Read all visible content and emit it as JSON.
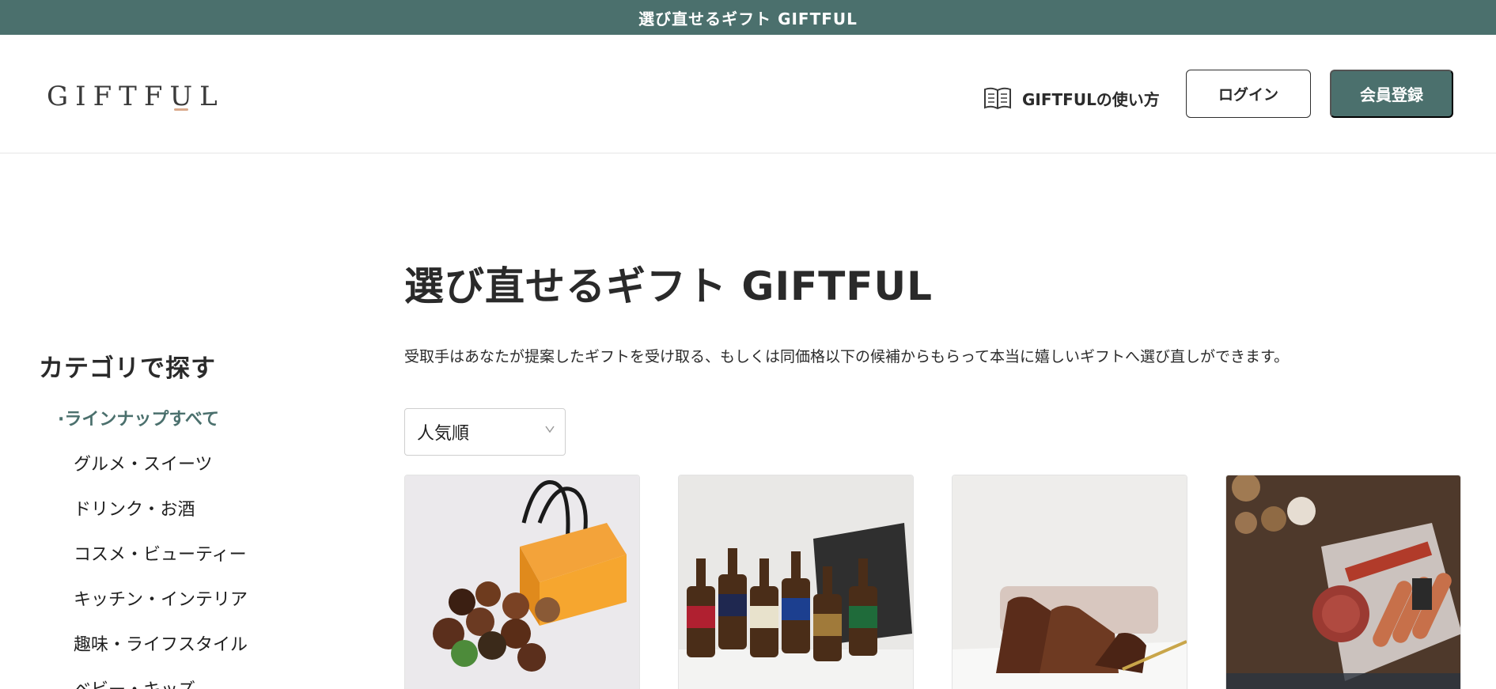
{
  "announcement": "選び直せるギフト GIFTFUL",
  "header": {
    "logo_text": "GIFTFUL",
    "howto_label": "GIFTFULの使い方",
    "login_label": "ログイン",
    "register_label": "会員登録"
  },
  "sidebar": {
    "title": "カテゴリで探す",
    "items": [
      {
        "label": "·ラインナップすべて",
        "active": true
      },
      {
        "label": "グルメ・スイーツ"
      },
      {
        "label": "ドリンク・お酒"
      },
      {
        "label": "コスメ・ビューティー"
      },
      {
        "label": "キッチン・インテリア"
      },
      {
        "label": "趣味・ライフスタイル"
      },
      {
        "label": "ベビー・キッズ"
      }
    ]
  },
  "main": {
    "title": "選び直せるギフト GIFTFUL",
    "description": "受取手はあなたが提案したギフトを受け取る、もしくは同価格以下の候補からもらって本当に嬉しいギフトへ選び直しができます。",
    "sort_selected": "人気順"
  },
  "products": [
    {
      "image": "canele-gift-box"
    },
    {
      "image": "coedo-beer-set"
    },
    {
      "image": "chocolate-cake"
    },
    {
      "image": "sausage-and-meat-set"
    }
  ],
  "colors": {
    "brand": "#4b706d",
    "logo_accent": "#d9a98b"
  }
}
